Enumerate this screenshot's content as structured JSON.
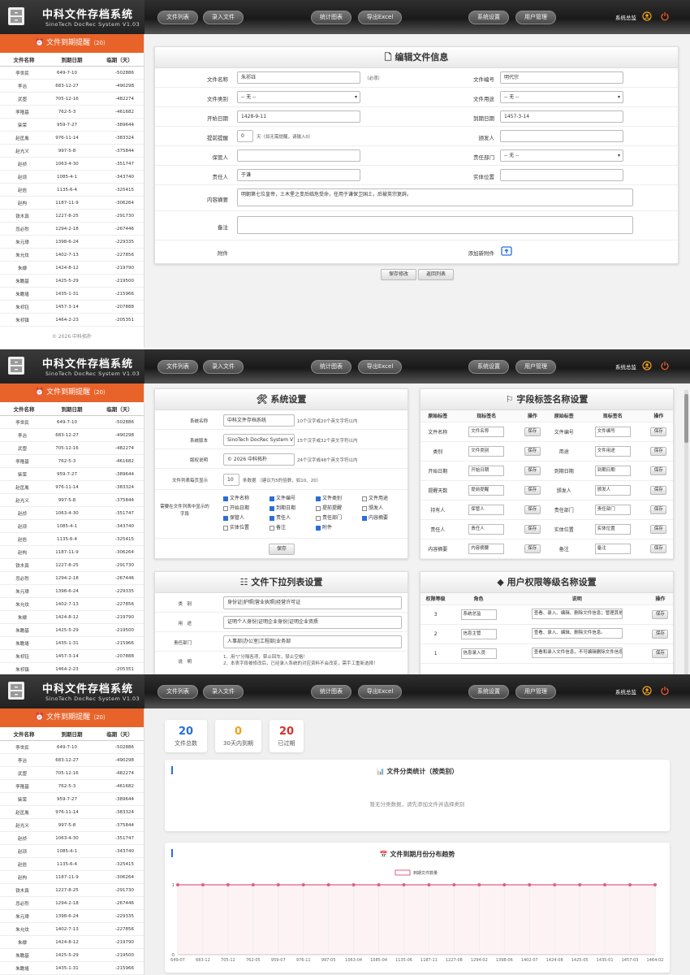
{
  "app": {
    "title": "中科文件存档系统",
    "subtitle": "SinoTech DocRec System V1.03"
  },
  "nav": {
    "file_list": "文件列表",
    "file_entry": "录入文件",
    "stats_chart": "统计图表",
    "export_excel": "导出Excel",
    "system_settings": "系统设置",
    "user_manage": "用户管理",
    "user_name": "系统总监"
  },
  "sidebar": {
    "title": "文件到期提醒",
    "count": "（20）",
    "columns": [
      "文件名称",
      "到期日期",
      "临期（天）"
    ],
    "rows": [
      [
        "李世民",
        "649-7-10",
        "-502886"
      ],
      [
        "李治",
        "683-12-27",
        "-490298"
      ],
      [
        "武曌",
        "705-12-16",
        "-482274"
      ],
      [
        "李隆基",
        "762-5-3",
        "-461682"
      ],
      [
        "柴荣",
        "959-7-27",
        "-389644"
      ],
      [
        "赵匡胤",
        "976-11-14",
        "-383324"
      ],
      [
        "赵光义",
        "997-5-8",
        "-375844"
      ],
      [
        "赵祯",
        "1063-4-30",
        "-351747"
      ],
      [
        "赵顼",
        "1085-4-1",
        "-343740"
      ],
      [
        "赵佶",
        "1135-6-4",
        "-325415"
      ],
      [
        "赵构",
        "1187-11-9",
        "-306264"
      ],
      [
        "铁木真",
        "1227-8-25",
        "-291730"
      ],
      [
        "忽必烈",
        "1294-2-18",
        "-267446"
      ],
      [
        "朱元璋",
        "1398-6-24",
        "-229335"
      ],
      [
        "朱允炆",
        "1402-7-13",
        "-227856"
      ],
      [
        "朱棣",
        "1424-8-12",
        "-219790"
      ],
      [
        "朱瞻基",
        "1425-5-29",
        "-219500"
      ],
      [
        "朱瞻墡",
        "1435-1-31",
        "-215966"
      ],
      [
        "朱祁钰",
        "1457-3-14",
        "-207888"
      ],
      [
        "朱祁镇",
        "1464-2-23",
        "-205351"
      ]
    ],
    "footer": "© 2026 中科拓朴"
  },
  "edit": {
    "title": "编辑文件信息",
    "labels": {
      "name": "文件名称",
      "number": "文件编号",
      "category": "文件类别",
      "purpose": "文件用途",
      "start": "开始日期",
      "end": "到期日期",
      "remind": "提前提醒",
      "issuer": "颁发人",
      "keeper": "保管人",
      "dept": "责任部门",
      "responsible": "责任人",
      "location": "实体位置",
      "summary": "内容摘要",
      "remark": "备注",
      "attach": "附件",
      "add_attach": "添加新附件"
    },
    "values": {
      "name": "朱祁钰",
      "name_hint": "（必须）",
      "number": "明代宗",
      "category": "-- 无 --",
      "purpose": "-- 无 --",
      "start": "1428-9-11",
      "end": "1457-3-14",
      "remind": "0",
      "remind_hint": "天（如无需提醒，请输入0）",
      "issuer": "",
      "keeper": "",
      "dept": "-- 无 --",
      "responsible": "于谦",
      "location": "",
      "summary": "明朝第七位皇帝，土木堡之变后临危受命，任用于谦保卫国土，后被英宗复辟。",
      "remark": ""
    },
    "save": "保存修改",
    "back": "返回列表"
  },
  "settings": {
    "title": "系统设置",
    "sys_name_label": "系统名称",
    "sys_name": "中科文件存档系统",
    "sys_name_hint": "10个汉字或20个英文字符以内",
    "sys_ver_label": "系统版本",
    "sys_ver": "SinoTech DocRec System V1.03",
    "sys_ver_hint": "15个汉字或32个英文字符以内",
    "copyright_label": "版权说明",
    "copyright": "© 2026 中科拓朴",
    "copyright_hint": "24个汉字或48个英文字符以内",
    "page_label": "文件列表每页显示",
    "page_size": "10",
    "page_hint": "条数据 （建议为5的倍数，如10、20）",
    "fields_label": "需要在文件列表中显示的字段",
    "fields": [
      {
        "t": "文件名称",
        "on": true
      },
      {
        "t": "文件编号",
        "on": true
      },
      {
        "t": "文件类别",
        "on": true
      },
      {
        "t": "文件用途",
        "on": false
      },
      {
        "t": "开始日期",
        "on": false
      },
      {
        "t": "到期日期",
        "on": true
      },
      {
        "t": "提前提醒",
        "on": false
      },
      {
        "t": "颁发人",
        "on": false
      },
      {
        "t": "保管人",
        "on": true
      },
      {
        "t": "责任人",
        "on": true
      },
      {
        "t": "责任部门",
        "on": false
      },
      {
        "t": "内容摘要",
        "on": true
      },
      {
        "t": "实体位置",
        "on": false
      },
      {
        "t": "备注",
        "on": false
      },
      {
        "t": "附件",
        "on": true
      }
    ],
    "save": "保存"
  },
  "labels_panel": {
    "title": "字段标签名称设置",
    "cols": [
      "原始标签",
      "现标签名",
      "操作",
      "原始标签",
      "现标签名",
      "操作"
    ],
    "rows": [
      [
        "文件名称",
        "文件名称",
        "文件编号",
        "文件编号"
      ],
      [
        "类别",
        "文件类别",
        "用途",
        "文件用途"
      ],
      [
        "开始日期",
        "开始日期",
        "到期日期",
        "到期日期"
      ],
      [
        "提醒天数",
        "提前提醒",
        "颁发人",
        "颁发人"
      ],
      [
        "持有人",
        "保管人",
        "责任部门",
        "责任部门"
      ],
      [
        "责任人",
        "责任人",
        "实体位置",
        "实体位置"
      ],
      [
        "内容摘要",
        "内容摘要",
        "备注",
        "备注"
      ]
    ],
    "save": "保存"
  },
  "dropdown_panel": {
    "title": "文件下拉列表设置",
    "rows": [
      {
        "label": "类　别",
        "value": "身份证|护照|营业执照|经营许可证"
      },
      {
        "label": "用　途",
        "value": "证明个人身份|证明企业身份|证明企业资质"
      },
      {
        "label": "责任部门",
        "value": "人事部|办公室|工程部|业务部"
      }
    ],
    "note_label": "说　明",
    "notes": [
      "1、用\"|\"分隔各项，禁止回车，禁止空格！",
      "2、本表字段被修改后，已经录入系统的对应资料不会改变，需手工重新选择！"
    ]
  },
  "roles_panel": {
    "title": "用户权限等级名称设置",
    "cols": [
      "权限等级",
      "角色",
      "说明",
      "操作"
    ],
    "rows": [
      [
        "3",
        "系统总监",
        "查看、录入、编辑、删除文件信息；管理其他"
      ],
      [
        "2",
        "信息主管",
        "查看、录入、编辑、删除文件信息。"
      ],
      [
        "1",
        "信息录入员",
        "查看和录入文件信息，不可编辑删除文件信息"
      ]
    ],
    "save": "保存"
  },
  "stats": {
    "cards": [
      {
        "num": "20",
        "label": "文件总数",
        "color": "#2a6ed9"
      },
      {
        "num": "0",
        "label": "30天内到期",
        "color": "#f0a020"
      },
      {
        "num": "20",
        "label": "已过期",
        "color": "#d9302a"
      }
    ],
    "cat_title": "文件分类统计（按类别）",
    "cat_empty": "暂无分类数据，请先添加文件并选择类别",
    "trend_title": "文件到期月份分布趋势"
  },
  "chart_data": {
    "type": "line",
    "title": "文件到期月份分布趋势",
    "series": [
      {
        "name": "到期文件数量",
        "values": [
          1,
          1,
          1,
          1,
          1,
          1,
          1,
          1,
          1,
          1,
          1,
          1,
          1,
          1,
          1,
          1,
          1,
          1,
          1,
          1
        ]
      }
    ],
    "categories": [
      "649-07",
      "683-12",
      "705-12",
      "762-05",
      "959-07",
      "976-11",
      "997-05",
      "1063-04",
      "1085-04",
      "1135-06",
      "1187-11",
      "1227-08",
      "1294-02",
      "1398-06",
      "1402-07",
      "1424-08",
      "1425-05",
      "1435-01",
      "1457-03",
      "1464-02"
    ],
    "ylim": [
      0,
      1
    ],
    "yticks": [
      "0",
      "1"
    ],
    "color": "#e06080"
  }
}
